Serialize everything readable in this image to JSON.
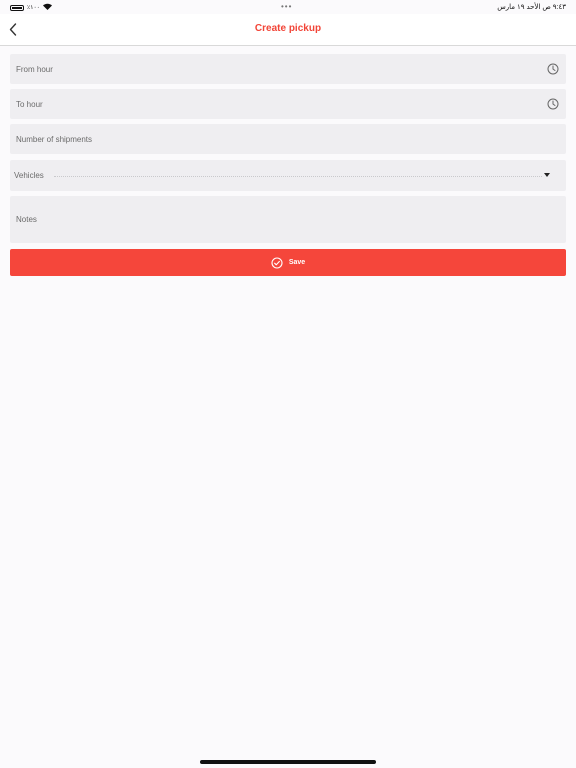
{
  "status_bar": {
    "battery": "٪١٠٠",
    "datetime": "٩:٤٣ ص   الأحد ١٩ مارس",
    "multitask": "•••"
  },
  "header": {
    "title": "Create pickup"
  },
  "form": {
    "from_hour": "From hour",
    "to_hour": "To hour",
    "shipments": "Number of shipments",
    "vehicles": "Vehicles",
    "notes": "Notes"
  },
  "actions": {
    "save_label": "Save"
  },
  "colors": {
    "accent": "#f5463b",
    "title": "#f24437",
    "field_bg": "#efeef1"
  },
  "icons": {
    "back": "chevron-left-icon",
    "clock": "clock-icon",
    "dropdown": "caret-down-icon",
    "save": "check-circle-icon"
  }
}
